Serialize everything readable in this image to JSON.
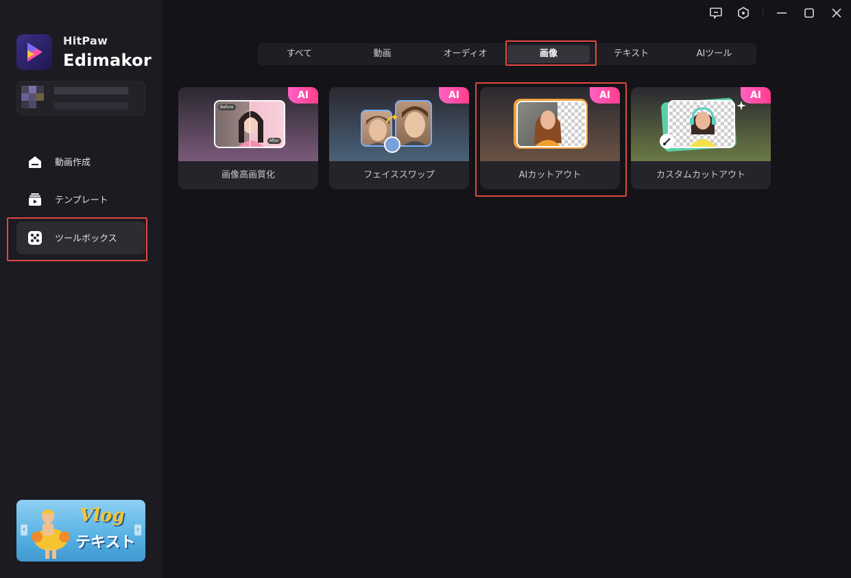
{
  "app": {
    "brand_top": "HitPaw",
    "brand_main": "Edimakor"
  },
  "sidebar": {
    "items": [
      {
        "label": "動画作成",
        "icon": "home-icon"
      },
      {
        "label": "テンプレート",
        "icon": "template-icon"
      },
      {
        "label": "ツールボックス",
        "icon": "toolbox-icon",
        "active": true
      }
    ],
    "promo": {
      "title": "Vlog",
      "subtitle": "テキスト"
    }
  },
  "tabs": [
    {
      "label": "すべて"
    },
    {
      "label": "動画"
    },
    {
      "label": "オーディオ"
    },
    {
      "label": "画像",
      "active": true
    },
    {
      "label": "テキスト"
    },
    {
      "label": "AIツール"
    }
  ],
  "cards": [
    {
      "title": "画像高画質化",
      "badge": "AI",
      "before": "Before",
      "after": "After"
    },
    {
      "title": "フェイススワップ",
      "badge": "AI"
    },
    {
      "title": "AIカットアウト",
      "badge": "AI"
    },
    {
      "title": "カスタムカットアウト",
      "badge": "AI"
    }
  ],
  "colors": {
    "highlight": "#e04a3f",
    "badge": "#ff4fa8",
    "background": "#141318",
    "sidebar": "#1c1b21"
  }
}
